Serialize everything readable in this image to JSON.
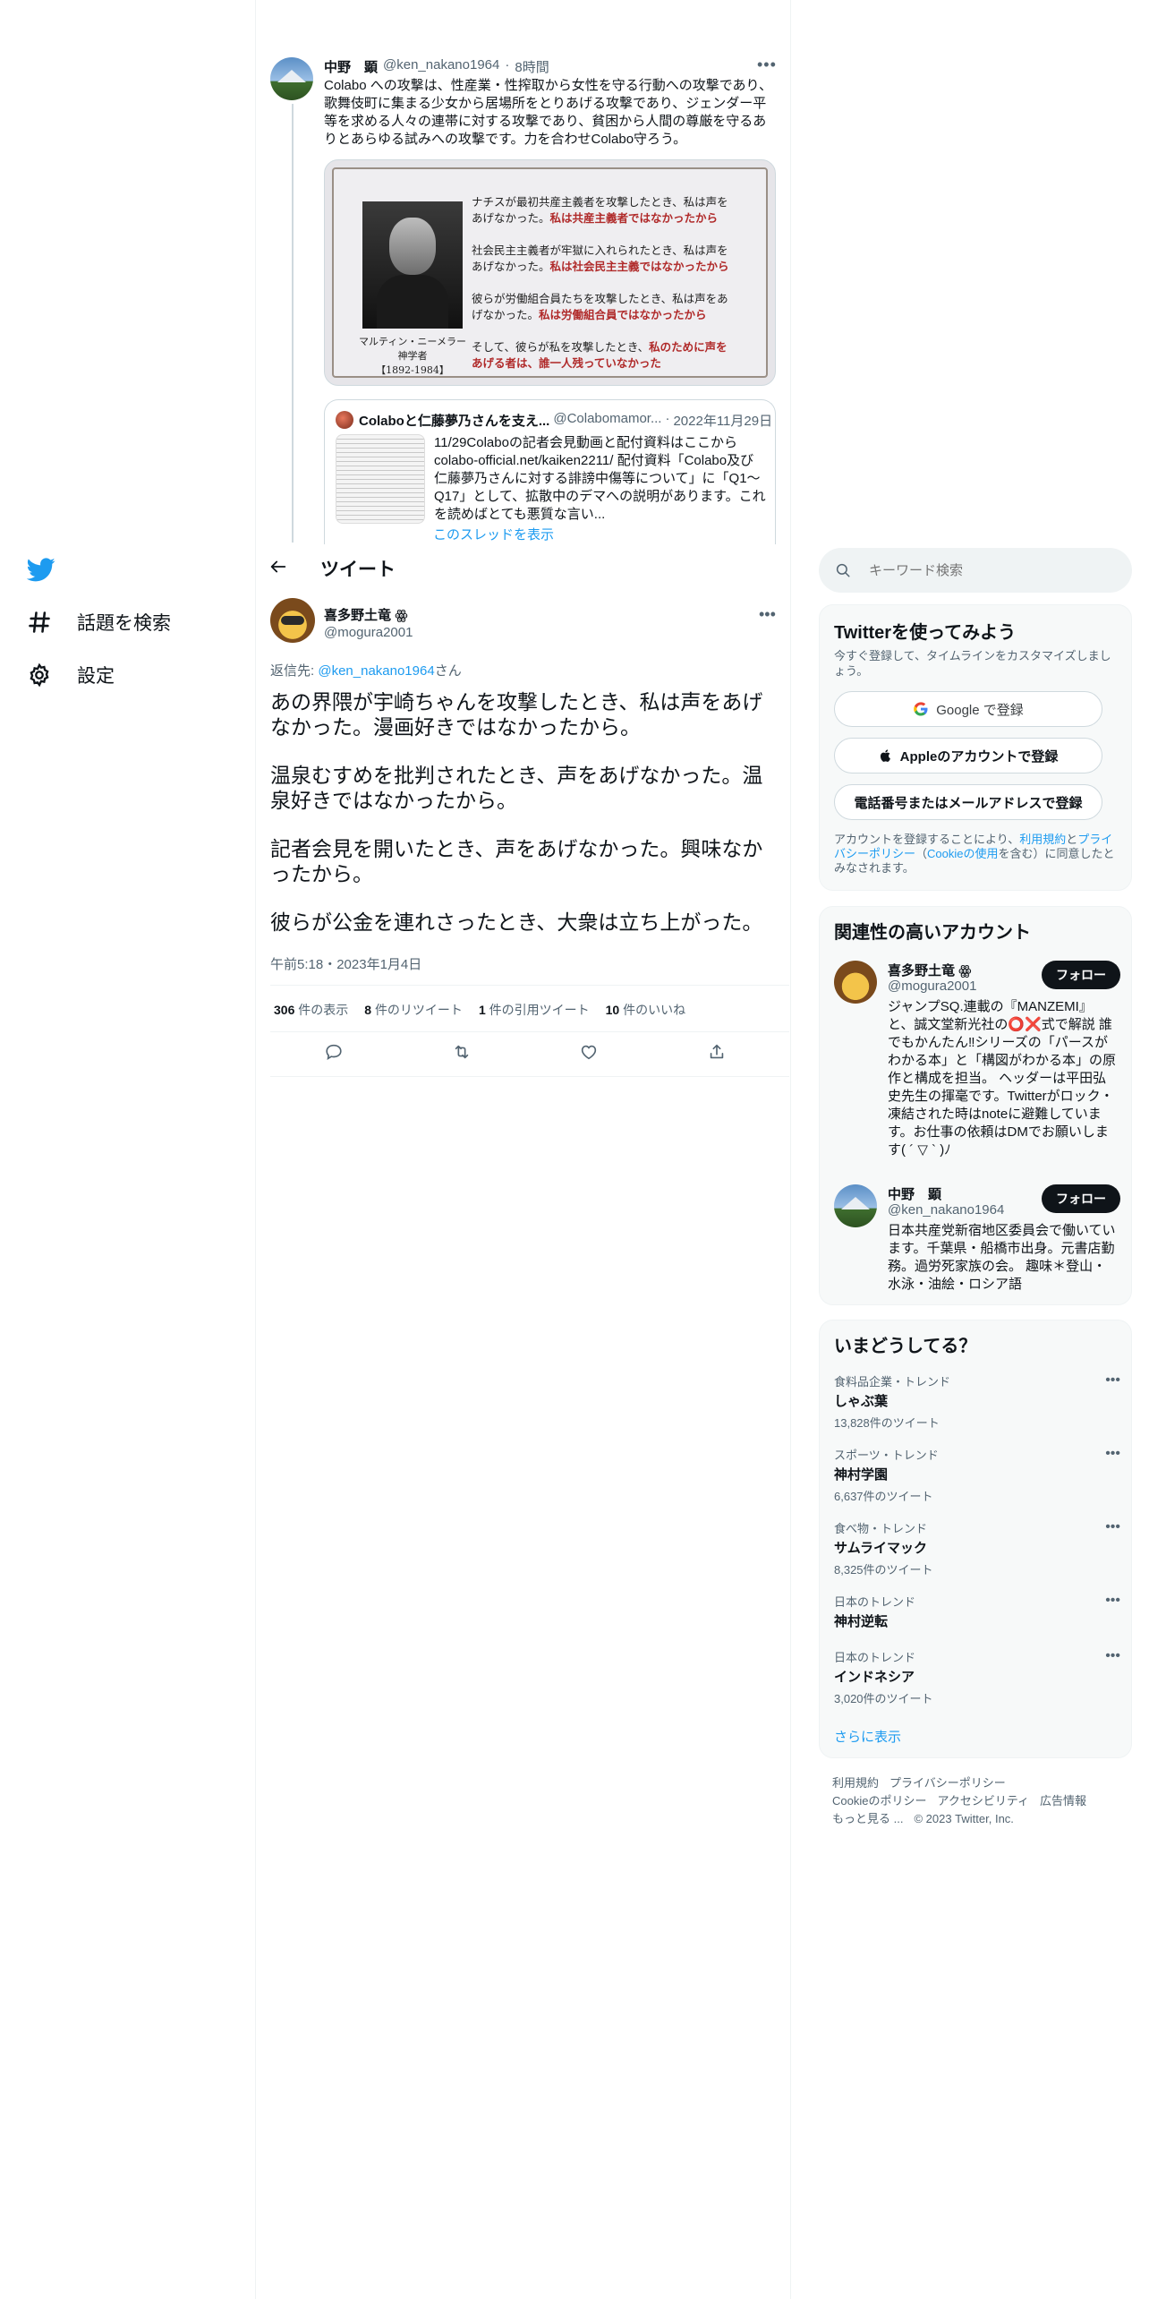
{
  "nav": {
    "explore_label": "話題を検索",
    "settings_label": "設定"
  },
  "context_tweet": {
    "name": "中野　顕",
    "handle": "@ken_nakano1964",
    "time": "8時間",
    "text": "Colabo への攻撃は、性産業・性搾取から女性を守る行動への攻撃であり、歌舞伎町に集まる少女から居場所をとりあげる攻撃であり、ジェンダー平等を求める人々の連帯に対する攻撃であり、貧困から人間の尊厳を守るありとあらゆる試みへの攻撃です。力を合わせColabo守ろう。",
    "image": {
      "caption_name": "マルティン・ニーメラー",
      "caption_role": "神学者",
      "caption_years": "【1892-1984】",
      "line1a": "ナチスが最初共産主義者を攻撃したとき、私は声を",
      "line1b": "あげなかった。",
      "line1c": "私は共産主義者ではなかったから",
      "line2a": "社会民主主義者が牢獄に入れられたとき、私は声を",
      "line2b": "あげなかった。",
      "line2c": "私は社会民主主義ではなかったから",
      "line3a": "彼らが労働組合員たちを攻撃したとき、私は声をあ",
      "line3b": "げなかった。",
      "line3c": "私は労働組合員ではなかったから",
      "line4a": "そして、彼らが私を攻撃したとき、",
      "line4b": "私のために声を",
      "line4c": "あげる者は、誰一人残っていなかった"
    },
    "quote": {
      "name": "Colaboと仁藤夢乃さんを支え...",
      "handle": "@Colabomamor...",
      "date": "2022年11月29日",
      "text": "11/29Colaboの記者会見動画と配付資料はここから colabo-official.net/kaiken2211/ 配付資料「Colabo及び仁藤夢乃さんに対する誹謗中傷等について」に「Q1～Q17」として、拡散中のデマへの説明があります。これを読めばとても悪質な言い..."
    },
    "show_thread": "このスレッドを表示"
  },
  "header": {
    "title": "ツイート"
  },
  "main_tweet": {
    "name": "喜多野土竜",
    "badge": "ꙮ",
    "handle": "@mogura2001",
    "reply_prefix": "返信先: ",
    "reply_handle": "@ken_nakano1964",
    "reply_suffix": "さん",
    "paragraphs": [
      "あの界隈が宇崎ちゃんを攻撃したとき、私は声をあげなかった。漫画好きではなかったから。",
      "温泉むすめを批判されたとき、声をあげなかった。温泉好きではなかったから。",
      "記者会見を開いたとき、声をあげなかった。興味なかったから。",
      "彼らが公金を連れさったとき、大衆は立ち上がった。"
    ],
    "timestamp": "午前5:18・2023年1月4日",
    "stats": {
      "views_count": "306",
      "views_label": "件の表示",
      "retweets_count": "8",
      "retweets_label": "件のリツイート",
      "quotes_count": "1",
      "quotes_label": "件の引用ツイート",
      "likes_count": "10",
      "likes_label": "件のいいね"
    }
  },
  "search": {
    "placeholder": "キーワード検索"
  },
  "signup": {
    "title": "Twitterを使ってみよう",
    "note": "今すぐ登録して、タイムラインをカスタマイズしましょう。",
    "google_label": "Google で登録",
    "apple_label": "Appleのアカウントで登録",
    "phone_label": "電話番号またはメールアドレスで登録",
    "terms_prefix": "アカウントを登録することにより、",
    "terms_link1": "利用規約",
    "terms_and": "と",
    "terms_link2": "プライバシーポリシー",
    "terms_paren_open": "（",
    "terms_link3": "Cookieの使用",
    "terms_suffix": "を含む）に同意したとみなされます。"
  },
  "related": {
    "title": "関連性の高いアカウント",
    "accounts": [
      {
        "name": "喜多野土竜 ꙮ",
        "handle": "@mogura2001",
        "bio": "ジャンプSQ.連載の『MANZEMI』と、誠文堂新光社の⭕❌式で解説 誰でもかんたん‼シリーズの「パースがわかる本」と「構図がわかる本」の原作と構成を担当。 ヘッダーは平田弘史先生の揮毫です。Twitterがロック・凍結された時はnoteに避難しています。お仕事の依頼はDMでお願いします( ´ ▽ ` )ﾉ",
        "follow": "フォロー"
      },
      {
        "name": "中野　顕",
        "handle": "@ken_nakano1964",
        "bio": "日本共産党新宿地区委員会で働いています。千葉県・船橋市出身。元書店勤務。過労死家族の会。 趣味＊登山・水泳・油絵・ロシア語",
        "follow": "フォロー"
      }
    ]
  },
  "trends": {
    "title": "いまどうしてる？",
    "items": [
      {
        "category": "食料品企業・トレンド",
        "name": "しゃぶ葉",
        "count": "13,828件のツイート"
      },
      {
        "category": "スポーツ・トレンド",
        "name": "神村学園",
        "count": "6,637件のツイート"
      },
      {
        "category": "食べ物・トレンド",
        "name": "サムライマック",
        "count": "8,325件のツイート"
      },
      {
        "category": "日本のトレンド",
        "name": "神村逆転",
        "count": ""
      },
      {
        "category": "日本のトレンド",
        "name": "インドネシア",
        "count": "3,020件のツイート"
      }
    ],
    "show_more": "さらに表示"
  },
  "footer": {
    "terms": "利用規約",
    "privacy": "プライバシーポリシー",
    "cookies": "Cookieのポリシー",
    "accessibility": "アクセシビリティ",
    "ads": "広告情報",
    "more": "もっと見る ...",
    "copyright": "© 2023 Twitter, Inc."
  },
  "colors": {
    "accent": "#1d9bf0",
    "text": "#0f1419",
    "muted": "#536471",
    "border": "#eff3f4"
  }
}
